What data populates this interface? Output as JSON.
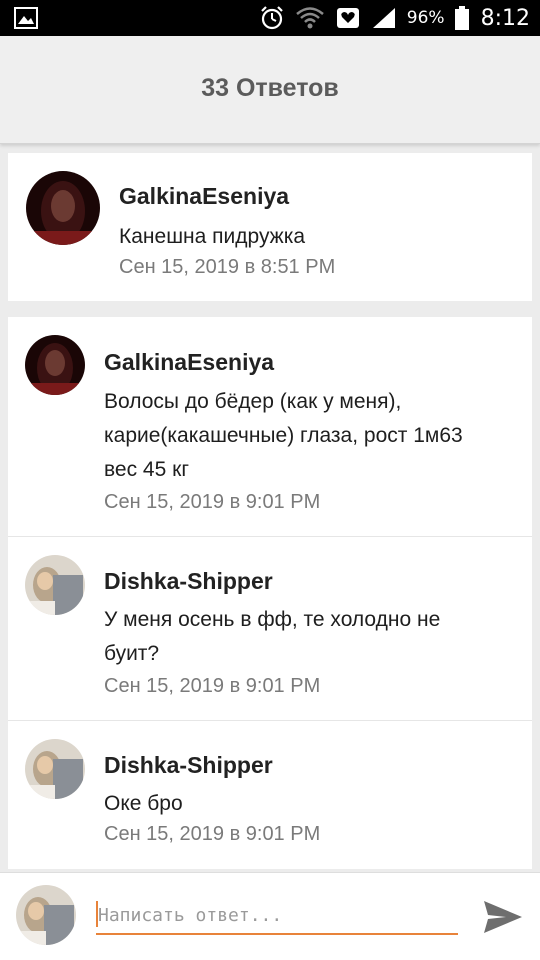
{
  "status_bar": {
    "battery": "96%",
    "time": "8:12",
    "icons": [
      "gallery-icon",
      "alarm-icon",
      "wifi-icon",
      "notification-heart-icon",
      "signal-icon",
      "battery-icon"
    ]
  },
  "header": {
    "title": "33 Ответов"
  },
  "parent_comment": {
    "author": "GalkinaEseniya",
    "text": "Канешна пидружка",
    "date": "Сен 15, 2019 в 8:51 PM"
  },
  "replies": [
    {
      "author": "GalkinaEseniya",
      "text_lines": [
        "Волосы до бёдер (как у меня),",
        "карие(какашечные) глаза, рост 1м63",
        "вес 45 кг"
      ],
      "date": "Сен 15, 2019 в 9:01 PM"
    },
    {
      "author": "Dishka-Shipper",
      "text_lines": [
        "У меня осень в фф, те холодно не",
        "буит?"
      ],
      "date": "Сен 15, 2019 в 9:01 PM"
    },
    {
      "author": "Dishka-Shipper",
      "text_lines": [
        "Оке бро"
      ],
      "date": "Сен 15, 2019 в 9:01 PM"
    }
  ],
  "composer": {
    "placeholder": "Написать ответ...",
    "accent_color": "#e8833a"
  }
}
